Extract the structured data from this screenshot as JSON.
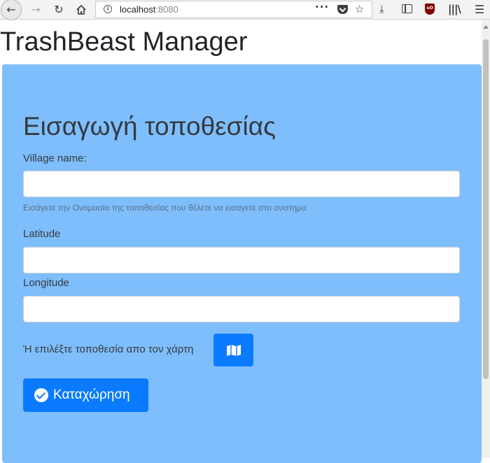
{
  "browser": {
    "url_host": "localhost",
    "url_port": ":8080"
  },
  "app": {
    "title": "TrashBeast Manager"
  },
  "form": {
    "heading": "Εισαγωγή τοποθεσίας",
    "village_label": "Village name:",
    "village_value": "",
    "village_help": "Εισάγετε την Ονομασία της τοποθεσίας που θέλετε να εισαγετε στο συστημα",
    "latitude_label": "Latitude",
    "latitude_value": "",
    "longitude_label": "Longitude",
    "longitude_value": "",
    "map_prompt": "Ή επιλέξτε τοποθεσία απο τον χάρτη",
    "map_button_icon": "map-icon",
    "submit_label": "Καταχώρηση",
    "submit_icon": "check-circle-icon"
  },
  "colors": {
    "card_background": "#7fbefc",
    "primary_button": "#0a7bff"
  }
}
